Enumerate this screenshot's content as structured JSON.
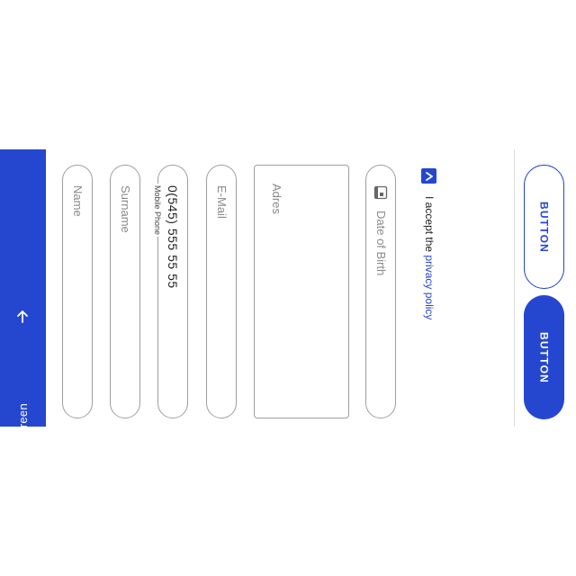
{
  "header": {
    "title": "Form Screen",
    "back_icon": "arrow-back-icon",
    "background": "#2547d0"
  },
  "form": {
    "name": {
      "placeholder": "Name"
    },
    "surname": {
      "placeholder": "Surname"
    },
    "phone": {
      "label": "Mobile Phone",
      "value": "0(545) 555 55 55"
    },
    "email": {
      "placeholder": "E-Mail"
    },
    "address": {
      "placeholder": "Adres"
    },
    "dob": {
      "placeholder": "Date of Birth",
      "icon": "calendar-icon"
    }
  },
  "privacy": {
    "checked": true,
    "prefix": "I accept the ",
    "link": "privacy policy"
  },
  "buttons": {
    "secondary_label": "BUTTON",
    "primary_label": "BUTTON"
  },
  "colors": {
    "accent": "#2547d0",
    "border": "#9e9e9e"
  }
}
